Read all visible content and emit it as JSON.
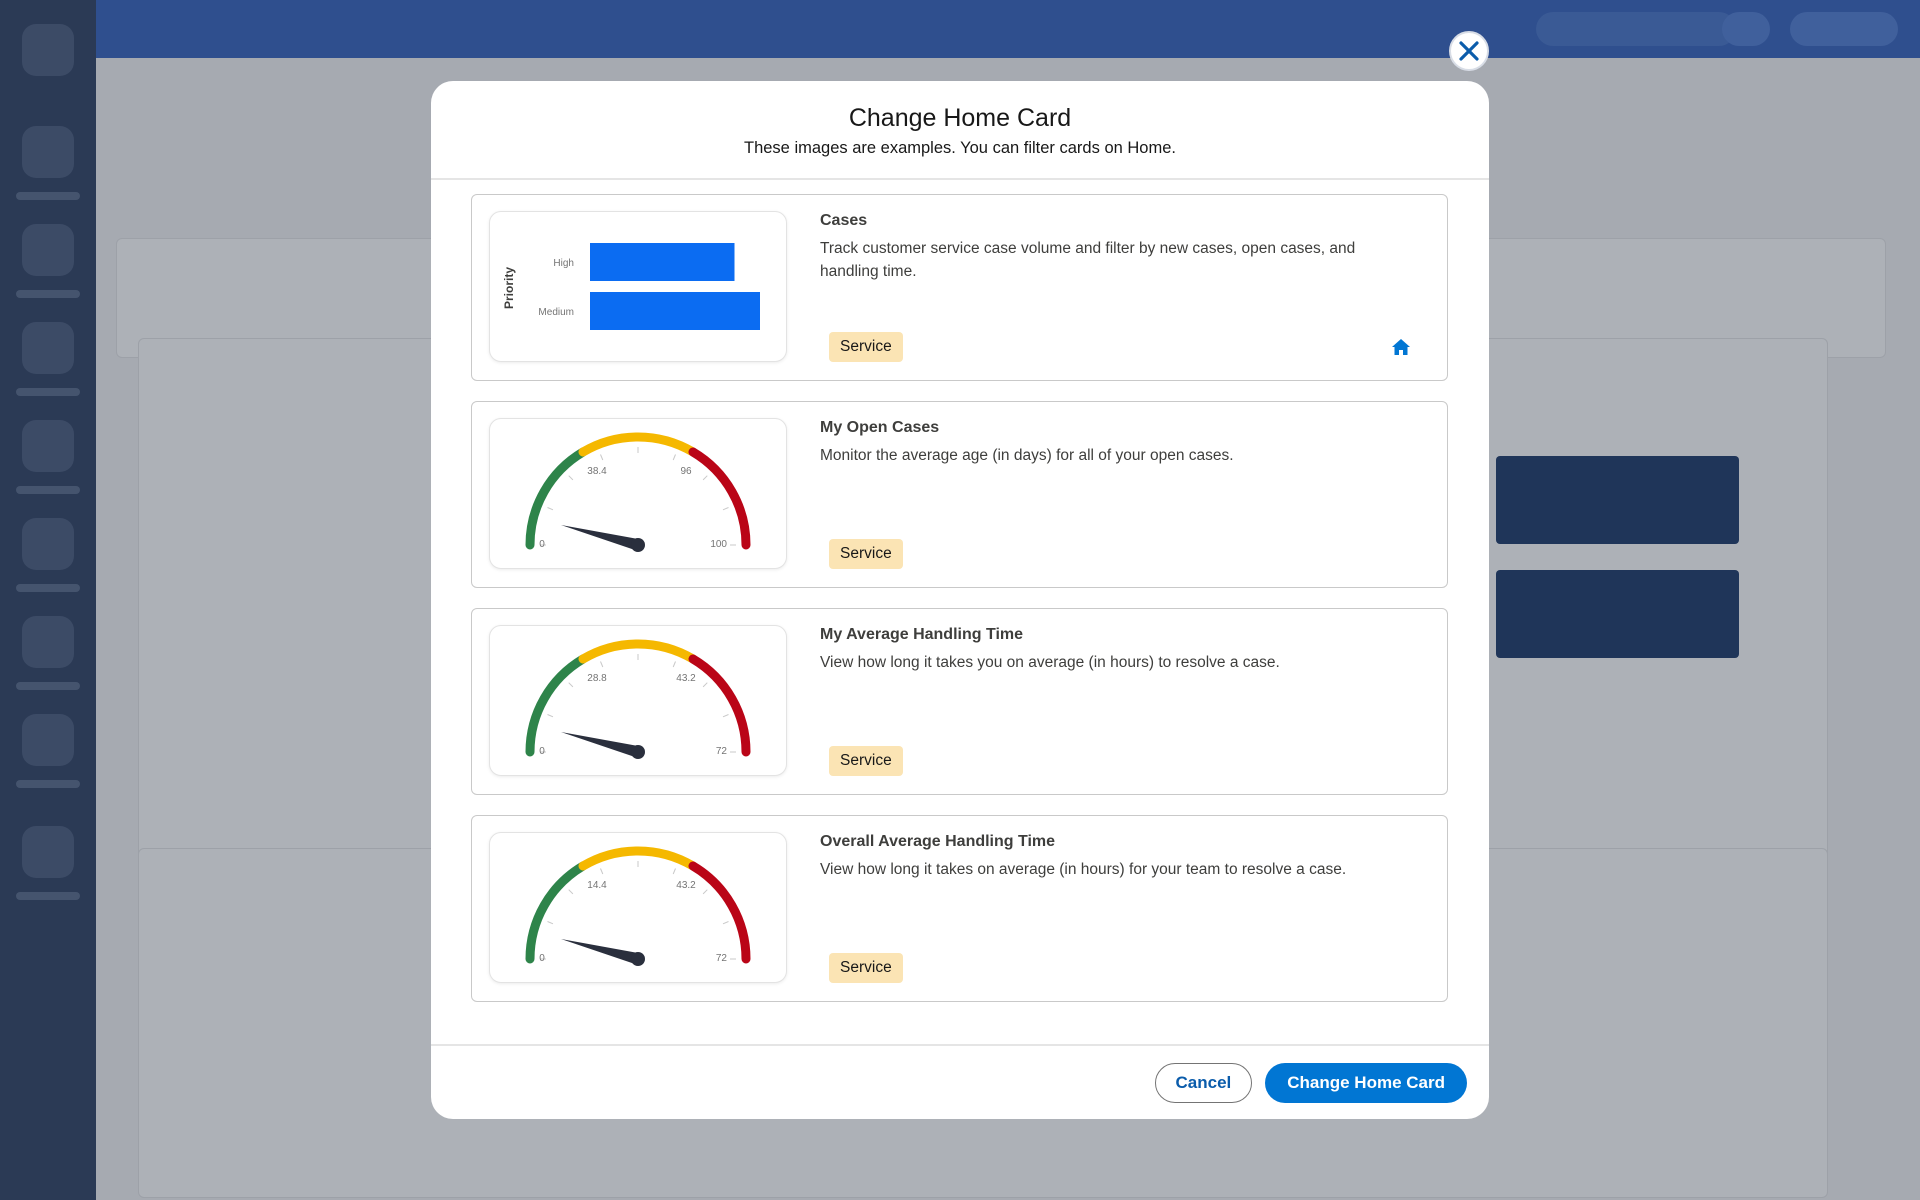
{
  "modal": {
    "title": "Change Home Card",
    "subtitle": "These images are examples. You can filter cards on Home.",
    "cancel_label": "Cancel",
    "confirm_label": "Change Home Card"
  },
  "cards": [
    {
      "title": "Cases",
      "description": "Track customer service case volume and filter by new cases, open cases, and handling time.",
      "badge": "Service",
      "preview": {
        "type": "bar",
        "axis_label": "Priority",
        "categories": [
          "High",
          "Medium"
        ],
        "values": [
          0.85,
          1.0
        ]
      }
    },
    {
      "title": "My Open Cases",
      "description": "Monitor the average age (in days) for all of your open cases.",
      "badge": "Service",
      "preview": {
        "type": "gauge",
        "labels": [
          "0",
          "38.4",
          "96",
          "100"
        ],
        "min": 0,
        "max": 100,
        "band1": 38.4,
        "band2": 96
      }
    },
    {
      "title": "My Average Handling Time",
      "description": "View how long it takes you on average (in hours) to resolve a case.",
      "badge": "Service",
      "preview": {
        "type": "gauge",
        "labels": [
          "0",
          "28.8",
          "43.2",
          "72"
        ],
        "min": 0,
        "max": 72,
        "band1": 28.8,
        "band2": 43.2
      }
    },
    {
      "title": "Overall Average Handling Time",
      "description": "View how long it takes on average (in hours) for your team to resolve a case.",
      "badge": "Service",
      "preview": {
        "type": "gauge",
        "labels": [
          "0",
          "14.4",
          "43.2",
          "72"
        ],
        "min": 0,
        "max": 72,
        "band1": 14.4,
        "band2": 43.2
      }
    }
  ],
  "colors": {
    "brand": "#0176d3",
    "bar": "#0b6cf2",
    "gauge_green": "#2e844a",
    "gauge_yellow": "#f5b800",
    "gauge_red": "#ba0517",
    "needle": "#2a2f3d",
    "badge_bg": "#fbe4b4"
  },
  "icons": {
    "close": "close-icon",
    "home": "home-icon"
  }
}
